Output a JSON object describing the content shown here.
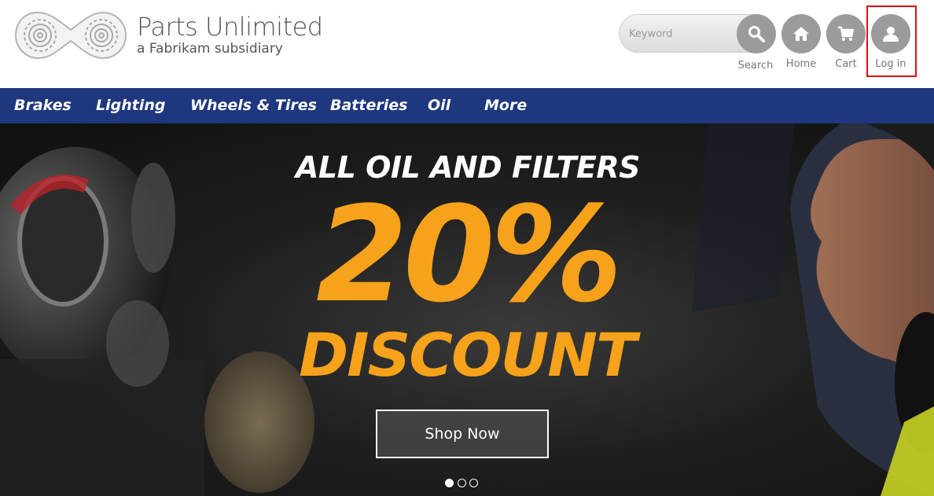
{
  "header": {
    "brand_name": "Parts Unlimited",
    "brand_subtitle": "a Fabrikam subsidiary",
    "search": {
      "placeholder": "Keyword",
      "label": "Search",
      "icon": "search-icon"
    },
    "actions": [
      {
        "label": "Home",
        "icon": "home-icon"
      },
      {
        "label": "Cart",
        "icon": "cart-icon"
      },
      {
        "label": "Log in",
        "icon": "user-icon"
      }
    ],
    "highlight_color": "#e01010"
  },
  "nav": {
    "background": "#1f377f",
    "items": [
      "Brakes",
      "Lighting",
      "Wheels & Tires",
      "Batteries",
      "Oil",
      "More"
    ]
  },
  "hero": {
    "headline": "ALL OIL AND FILTERS",
    "percent": "20%",
    "discount": "DISCOUNT",
    "accent_color": "#f7a21b",
    "cta_label": "Shop Now",
    "carousel": {
      "slides": 3,
      "active": 1
    }
  }
}
